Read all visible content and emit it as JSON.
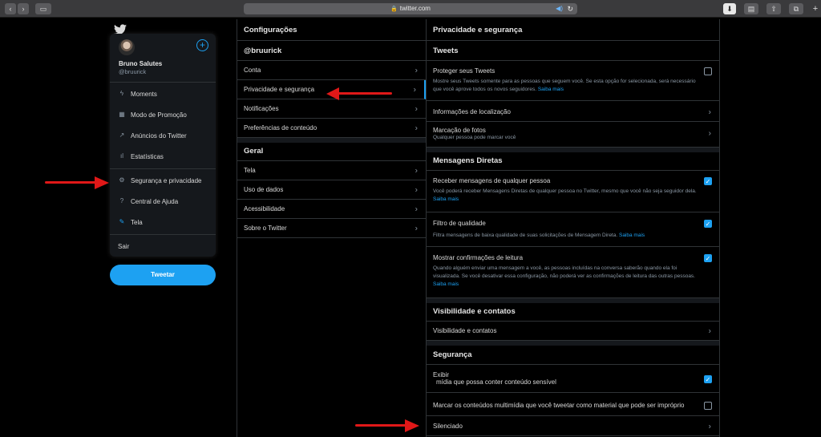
{
  "browser": {
    "url": "twitter.com"
  },
  "sidebar": {
    "user_name": "Bruno Salutes",
    "user_handle": "@bruurick",
    "items": [
      {
        "label": "Moments",
        "icon": "lightning-icon"
      },
      {
        "label": "Modo de Promoção",
        "icon": "grid-icon"
      },
      {
        "label": "Anúncios do Twitter",
        "icon": "external-link-icon"
      },
      {
        "label": "Estatísticas",
        "icon": "bar-chart-icon"
      },
      {
        "label": "Segurança e privacidade",
        "icon": "gear-icon"
      },
      {
        "label": "Central de Ajuda",
        "icon": "help-icon"
      },
      {
        "label": "Tela",
        "icon": "pen-icon"
      }
    ],
    "logout": "Sair",
    "tweet_button": "Tweetar"
  },
  "settings": {
    "title": "Configurações",
    "account_header": "@bruurick",
    "account_items": [
      "Conta",
      "Privacidade e segurança",
      "Notificações",
      "Preferências de conteúdo"
    ],
    "general_header": "Geral",
    "general_items": [
      "Tela",
      "Uso de dados",
      "Acessibilidade",
      "Sobre o Twitter"
    ]
  },
  "privacy": {
    "title": "Privacidade e segurança",
    "tweets_header": "Tweets",
    "protect_title": "Proteger seus Tweets",
    "protect_desc": "Mostre seus Tweets somente para as pessoas que seguem você. Se esta opção for selecionada, será necessário que você aprove todos os novos seguidores.",
    "saiba_mais": "Saiba mais",
    "location": "Informações de localização",
    "photo_tagging": "Marcação de fotos",
    "photo_tagging_sub": "Qualquer pessoa pode marcar você",
    "dm_header": "Mensagens Diretas",
    "dm_title": "Receber mensagens de qualquer pessoa",
    "dm_desc": "Você poderá receber Mensagens Diretas de qualquer pessoa no Twitter, mesmo que você não seja seguidor dela.",
    "quality_title": "Filtro de qualidade",
    "quality_desc": "Filtra mensagens de baixa qualidade de suas solicitações de Mensagem Direta.",
    "read_title": "Mostrar confirmações de leitura",
    "read_desc": "Quando alguém enviar uma mensagem a você, as pessoas incluídas na conversa saberão quando ela foi visualizada. Se você desativar essa configuração, não poderá ver as confirmações de leitura das outras pessoas.",
    "visibility_header": "Visibilidade e contatos",
    "visibility_item": "Visibilidade e contatos",
    "security_header": "Segurança",
    "sensitive_title": "Exibir",
    "sensitive_sub": "mídia que possa conter conteúdo sensível",
    "mark_media": "Marcar os conteúdos multimídia que você tweetar como material que pode ser impróprio",
    "muted": "Silenciado"
  }
}
